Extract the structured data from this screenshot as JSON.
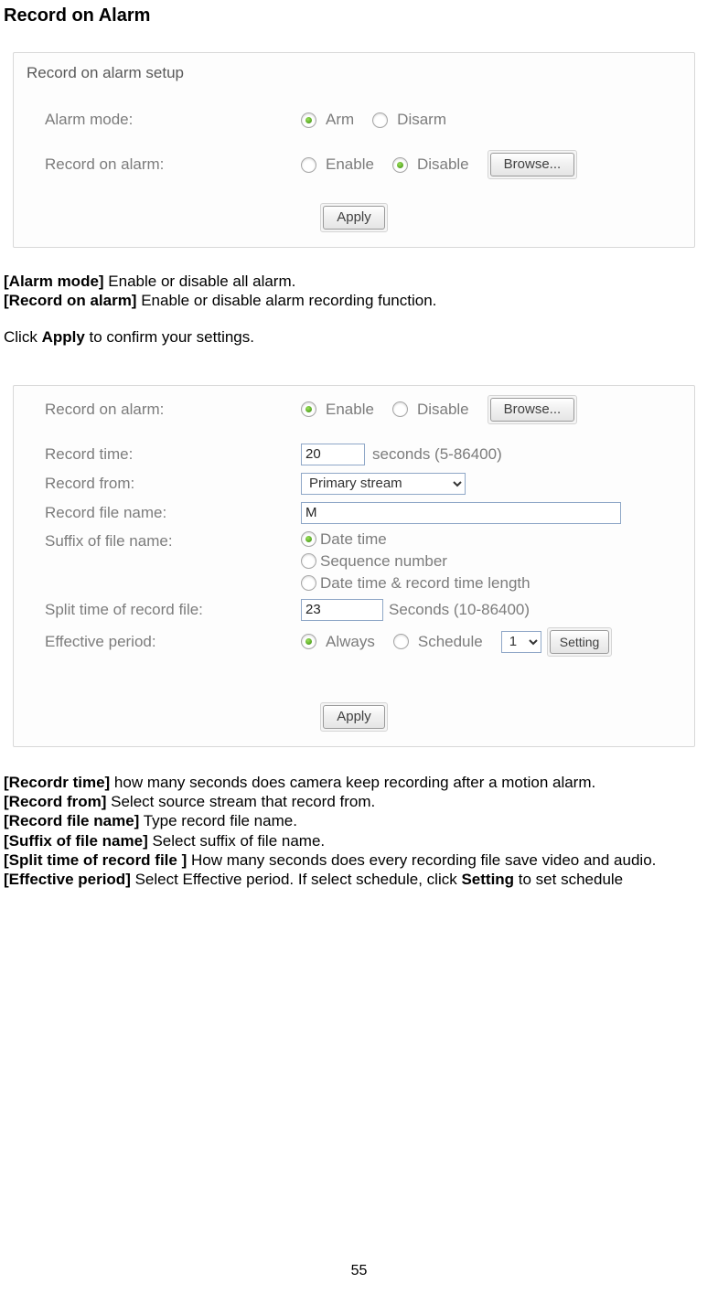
{
  "pageTitle": "Record on Alarm",
  "panel1": {
    "header": "Record on alarm setup",
    "alarmMode": {
      "label": "Alarm mode:",
      "optArm": "Arm",
      "optDisarm": "Disarm"
    },
    "recordOnAlarm": {
      "label": "Record on alarm:",
      "optEnable": "Enable",
      "optDisable": "Disable",
      "browse": "Browse..."
    },
    "apply": "Apply"
  },
  "desc1": {
    "l1a": "[Alarm mode]",
    "l1b": " Enable or disable all alarm.",
    "l2a": "[Record on alarm]",
    "l2b": " Enable or disable alarm recording function.",
    "l3a": "Click ",
    "l3b": "Apply",
    "l3c": " to confirm your settings."
  },
  "panel2": {
    "recordOnAlarm": {
      "label": "Record on alarm:",
      "optEnable": "Enable",
      "optDisable": "Disable",
      "browse": "Browse..."
    },
    "recordTime": {
      "label": "Record time:",
      "value": "20",
      "unit": "seconds (5-86400)"
    },
    "recordFrom": {
      "label": "Record from:",
      "value": "Primary stream"
    },
    "recordFileName": {
      "label": "Record file name:",
      "value": "M"
    },
    "suffix": {
      "label": "Suffix of file name:",
      "opt1": "Date time",
      "opt2": "Sequence number",
      "opt3": "Date time & record time length"
    },
    "splitTime": {
      "label": "Split time of record file:",
      "value": "23",
      "unit": "Seconds (10-86400)"
    },
    "effective": {
      "label": "Effective period:",
      "optAlways": "Always",
      "optSchedule": "Schedule",
      "selValue": "1",
      "setting": "Setting"
    },
    "apply": "Apply"
  },
  "desc2": {
    "l1a": "[Recordr time]",
    "l1b": " how many seconds does camera keep recording after a motion alarm.",
    "l2a": "[Record from]",
    "l2b": " Select source stream that record from.",
    "l3a": "[Record file name]",
    "l3b": " Type record file name.",
    "l4a": "[Suffix of file name]",
    "l4b": " Select suffix of file name.",
    "l5a": "[Split time of record file ]",
    "l5b": " How many seconds does every recording file save video and audio.",
    "l6a": "[Effective period]",
    "l6b": " Select Effective period. If select schedule, click ",
    "l6c": "Setting",
    "l6d": " to set schedule"
  },
  "pageNumber": "55"
}
